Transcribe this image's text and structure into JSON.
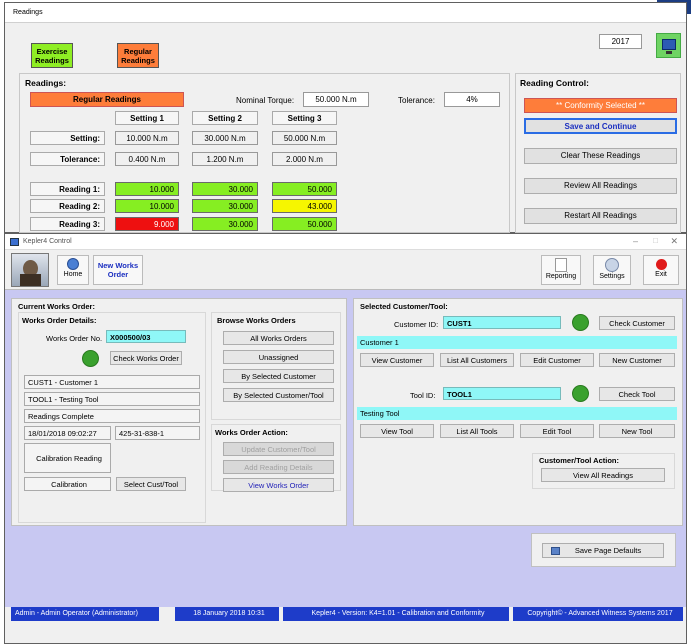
{
  "readings_window": {
    "title": "Readings",
    "exercise_btn": "Exercise Readings",
    "regular_btn": "Regular Readings",
    "year": "2017",
    "readings_title": "Readings:",
    "mode_label": "Regular Readings",
    "nominal_label": "Nominal Torque:",
    "nominal_value": "50.000 N.m",
    "tolerance_label": "Tolerance:",
    "tolerance_value": "4%",
    "settings": [
      "Setting 1",
      "Setting 2",
      "Setting 3"
    ],
    "row_setting_label": "Setting:",
    "setting_values": [
      "10.000 N.m",
      "30.000 N.m",
      "50.000 N.m"
    ],
    "row_tol_label": "Tolerance:",
    "tol_values": [
      "0.400 N.m",
      "1.200 N.m",
      "2.000 N.m"
    ],
    "reading_labels": [
      "Reading 1:",
      "Reading 2:",
      "Reading 3:"
    ],
    "readings": [
      [
        "10.000",
        "30.000",
        "50.000"
      ],
      [
        "10.000",
        "30.000",
        "43.000"
      ],
      [
        "9.000",
        "30.000",
        "50.000"
      ]
    ],
    "reading_colors": [
      [
        "g",
        "g",
        "g"
      ],
      [
        "g",
        "g",
        "y"
      ],
      [
        "r",
        "g",
        "g"
      ]
    ],
    "control_title": "Reading Control:",
    "conformity": "** Conformity Selected **",
    "save_continue": "Save and Continue",
    "clear": "Clear These Readings",
    "review": "Review All Readings",
    "restart": "Restart All Readings"
  },
  "kepler": {
    "title": "Kepler4 Control",
    "home": "Home",
    "new_works_order": "New Works Order",
    "reporting": "Reporting",
    "settings": "Settings",
    "exit": "Exit",
    "current_title": "Current Works Order:",
    "details_title": "Works Order Details:",
    "wo_no_label": "Works Order No.",
    "wo_no": "X000500/03",
    "check_wo": "Check Works Order",
    "customer": "CUST1 - Customer 1",
    "tool": "TOOL1 - Testing Tool",
    "status": "Readings Complete",
    "date": "18/01/2018 09:02:27",
    "code": "425-31-838-1",
    "cal_reading": "Calibration Reading",
    "calibration": "Calibration",
    "select_cust_tool": "Select Cust/Tool",
    "browse_title": "Browse Works Orders",
    "browse_items": [
      "All Works Orders",
      "Unassigned",
      "By Selected Customer",
      "By Selected Customer/Tool"
    ],
    "action_title": "Works Order Action:",
    "update_ct": "Update Customer/Tool",
    "add_reading": "Add Reading Details",
    "view_wo": "View Works Order",
    "sel_title": "Selected Customer/Tool:",
    "cust_id_label": "Customer ID:",
    "cust_id": "CUST1",
    "check_customer": "Check Customer",
    "cust_name": "Customer 1",
    "cust_btns": [
      "View Customer",
      "List All Customers",
      "Edit Customer",
      "New Customer"
    ],
    "tool_id_label": "Tool ID:",
    "tool_id": "TOOL1",
    "check_tool": "Check Tool",
    "tool_name": "Testing Tool",
    "tool_btns": [
      "View Tool",
      "List All Tools",
      "Edit Tool",
      "New Tool"
    ],
    "ct_action_title": "Customer/Tool Action:",
    "view_all_readings": "View All Readings",
    "save_defaults": "Save Page Defaults",
    "status_user": "Admin - Admin Operator (Administrator)",
    "status_date": "18 January 2018 10:31",
    "status_version": "Kepler4 - Version: K4=1.01 - Calibration and Conformity",
    "status_copy": "Copyright© - Advanced Witness Systems 2017"
  },
  "colors": {
    "green": "#86ee22",
    "yellow": "#f6f600",
    "red": "#ee1010",
    "orange": "#fe7d3a",
    "cyan": "#8ff7f7",
    "status_blue": "#1e3cc9"
  }
}
